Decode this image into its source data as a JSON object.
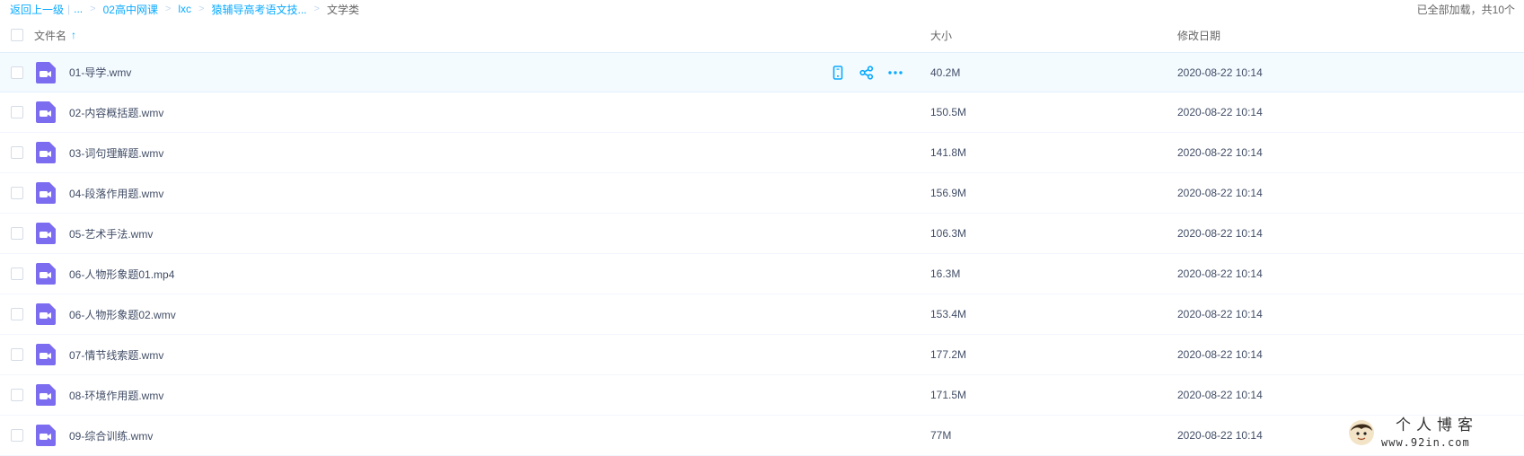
{
  "breadcrumb": {
    "back_label": "返回上一级",
    "ellipsis": "...",
    "items": [
      "02高中网课",
      "lxc",
      "猿辅导高考语文技..."
    ],
    "current": "文学类",
    "separator": ">"
  },
  "load_status": "已全部加载，共10个",
  "table": {
    "headers": {
      "name": "文件名",
      "sort_arrow": "↑",
      "size": "大小",
      "date": "修改日期"
    },
    "rows": [
      {
        "name": "01-导学.wmv",
        "size": "40.2M",
        "date": "2020-08-22 10:14"
      },
      {
        "name": "02-内容概括题.wmv",
        "size": "150.5M",
        "date": "2020-08-22 10:14"
      },
      {
        "name": "03-词句理解题.wmv",
        "size": "141.8M",
        "date": "2020-08-22 10:14"
      },
      {
        "name": "04-段落作用题.wmv",
        "size": "156.9M",
        "date": "2020-08-22 10:14"
      },
      {
        "name": "05-艺术手法.wmv",
        "size": "106.3M",
        "date": "2020-08-22 10:14"
      },
      {
        "name": "06-人物形象题01.mp4",
        "size": "16.3M",
        "date": "2020-08-22 10:14"
      },
      {
        "name": "06-人物形象题02.wmv",
        "size": "153.4M",
        "date": "2020-08-22 10:14"
      },
      {
        "name": "07-情节线索题.wmv",
        "size": "177.2M",
        "date": "2020-08-22 10:14"
      },
      {
        "name": "08-环境作用题.wmv",
        "size": "171.5M",
        "date": "2020-08-22 10:14"
      },
      {
        "name": "09-综合训练.wmv",
        "size": "77M",
        "date": "2020-08-22 10:14"
      }
    ]
  },
  "watermark": {
    "title": "个人博客",
    "url": "www.92in.com"
  },
  "colors": {
    "accent": "#09aaff",
    "file_icon": "#7b6cf0",
    "hover_row": "#f4fbff"
  }
}
